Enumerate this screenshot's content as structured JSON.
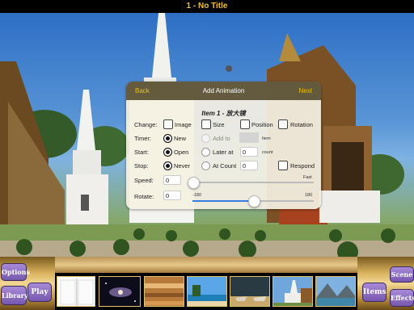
{
  "window": {
    "title": "1 - No Title"
  },
  "dialog": {
    "back_label": "Back",
    "title": "Add Animation",
    "next_label": "Next",
    "item_title": "Item 1 - 放大镜",
    "change": {
      "label": "Change:",
      "options": [
        "Image",
        "Size",
        "Position",
        "Rotation"
      ]
    },
    "timer": {
      "label": "Timer:",
      "new_label": "New",
      "add_to_label": "Add to",
      "item_label": "Item"
    },
    "start": {
      "label": "Start:",
      "open_label": "Open",
      "later_label": "Later at",
      "count_value": "0",
      "count_label": "count"
    },
    "stop": {
      "label": "Stop:",
      "never_label": "Never",
      "at_count_label": "At Count",
      "at_count_value": "0",
      "respond_label": "Respond"
    },
    "speed": {
      "label": "Speed:",
      "value": "0",
      "max_label": "Fast",
      "level": 0.0
    },
    "rotate": {
      "label": "Rotate:",
      "value": "0",
      "min_label": "-180",
      "max_label": "180",
      "level": 0.5
    }
  },
  "sidebar_left": {
    "options_label": "Options",
    "library_label": "Library",
    "play_label": "Play"
  },
  "sidebar_right": {
    "items_label": "Items",
    "scene_label": "Scene",
    "effects_label": "Effects"
  },
  "thumbnails": [
    "book-page-thumbnail",
    "galaxy-thumbnail",
    "wood-shelf-thumbnail",
    "beach-thumbnail",
    "boats-thumbnail",
    "temple-thumbnail",
    "mountain-lake-thumbnail"
  ],
  "colors": {
    "accent": "#f0c400",
    "title": "#f2c230",
    "badge": "#8a6cc4"
  }
}
